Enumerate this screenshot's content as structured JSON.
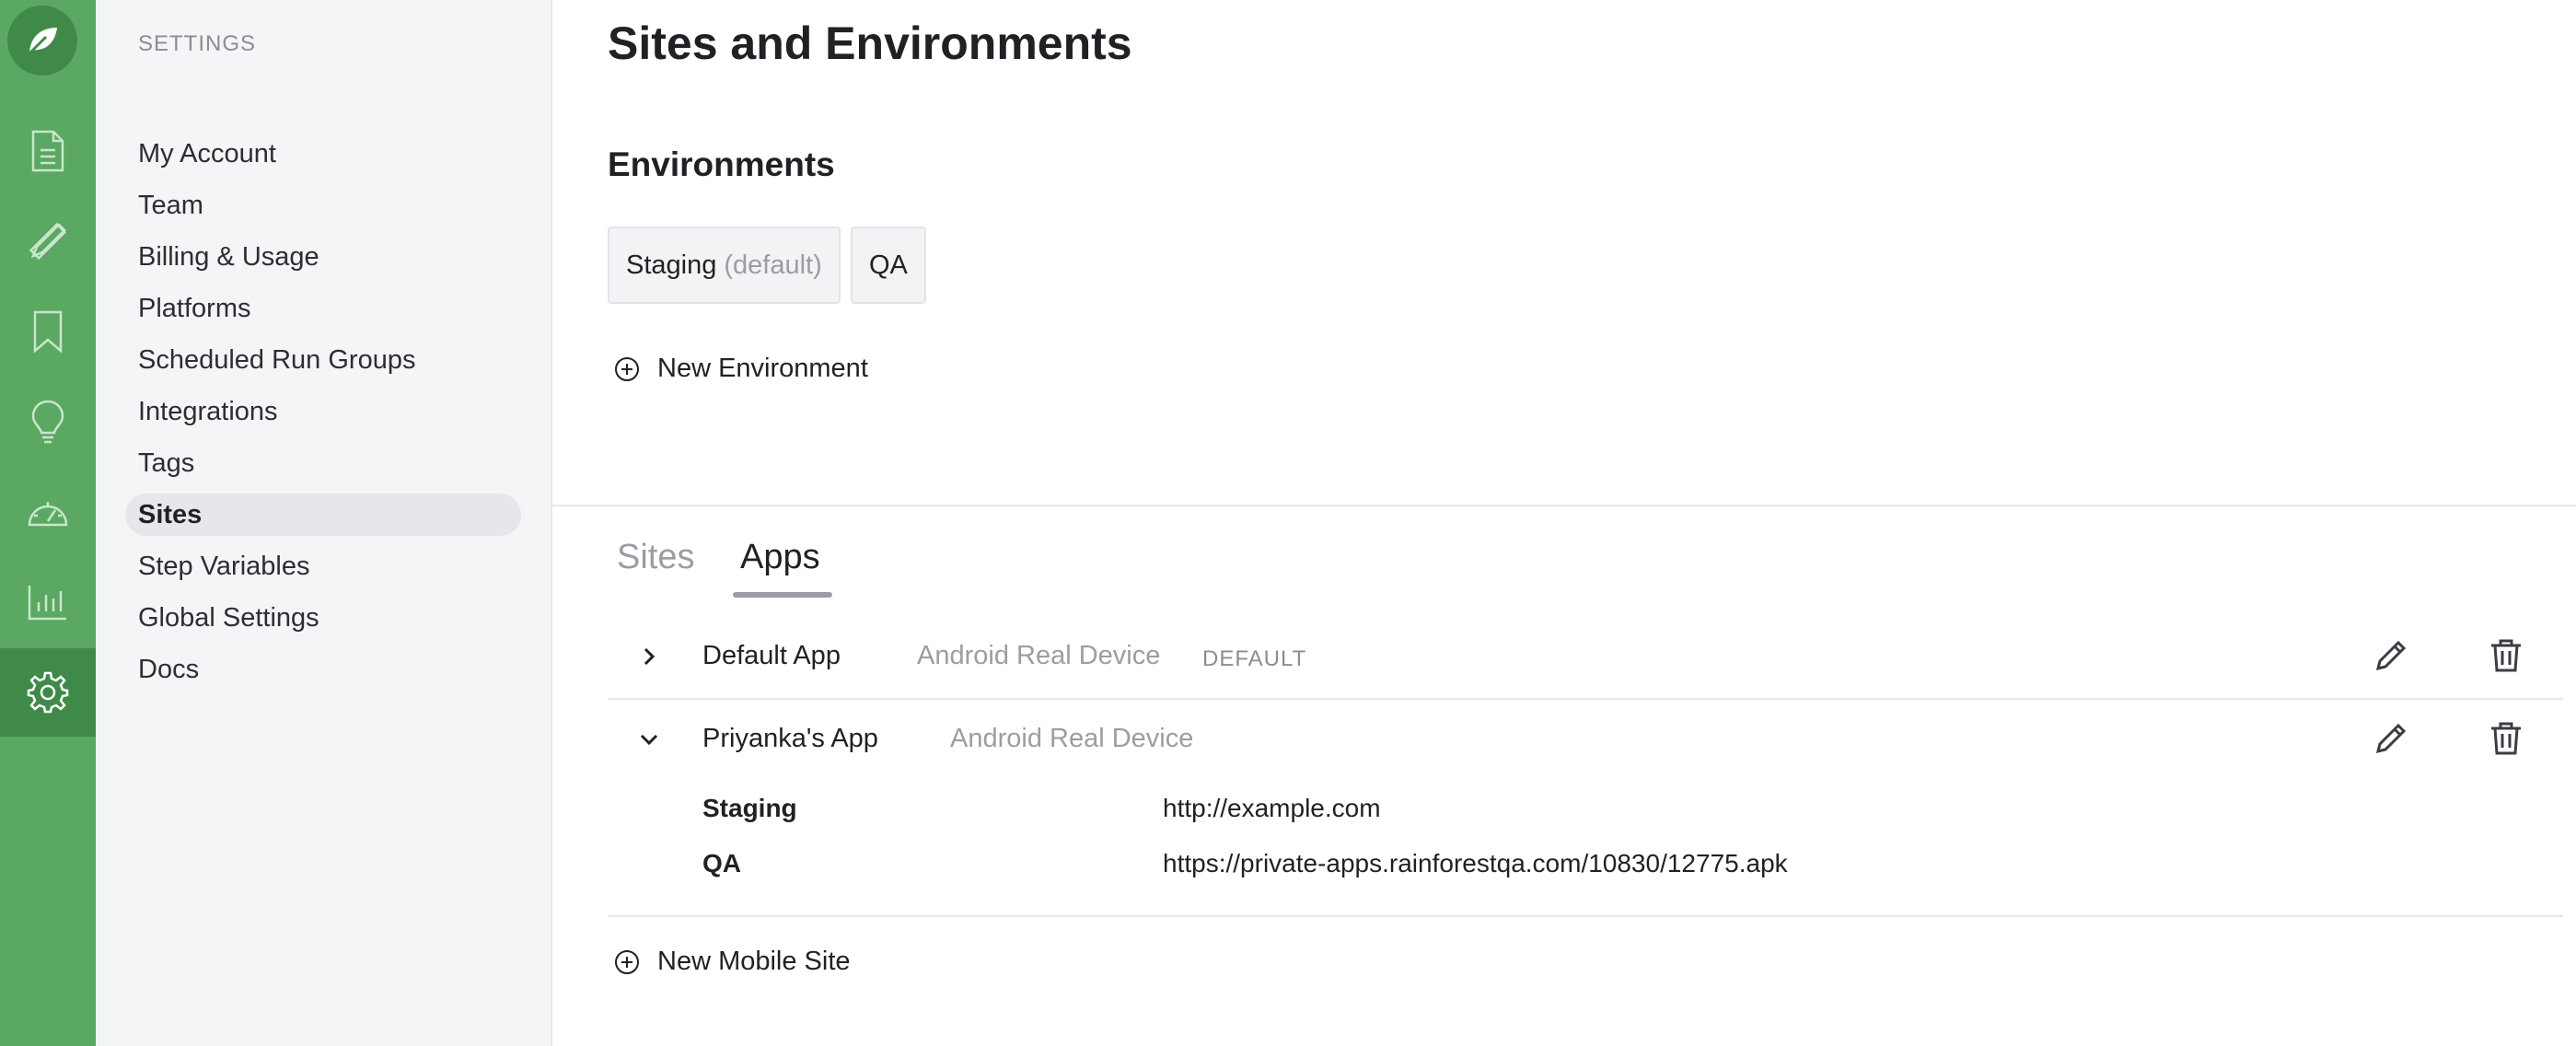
{
  "rail": {
    "icons": [
      "leaf-logo-icon",
      "document-icon",
      "pencil-ruler-icon",
      "bookmark-icon",
      "lightbulb-icon",
      "gauge-icon",
      "bar-chart-icon",
      "gear-icon"
    ],
    "active": "gear-icon",
    "color": "#5aa862",
    "active_color": "#3f8a49"
  },
  "sidebar": {
    "heading": "SETTINGS",
    "items": [
      {
        "label": "My Account"
      },
      {
        "label": "Team"
      },
      {
        "label": "Billing & Usage"
      },
      {
        "label": "Platforms"
      },
      {
        "label": "Scheduled Run Groups"
      },
      {
        "label": "Integrations"
      },
      {
        "label": "Tags"
      },
      {
        "label": "Sites",
        "active": true
      },
      {
        "label": "Step Variables"
      },
      {
        "label": "Global Settings"
      },
      {
        "label": "Docs"
      }
    ]
  },
  "main": {
    "title": "Sites and Environments",
    "environments": {
      "heading": "Environments",
      "chips": [
        {
          "label": "Staging",
          "suffix": "(default)"
        },
        {
          "label": "QA"
        }
      ],
      "new_label": "New Environment"
    },
    "tabs": [
      {
        "label": "Sites",
        "active": false
      },
      {
        "label": "Apps",
        "active": true
      }
    ],
    "apps": [
      {
        "name": "Default App",
        "platform": "Android Real Device",
        "badge": "DEFAULT",
        "expanded": false
      },
      {
        "name": "Priyanka's App",
        "platform": "Android Real Device",
        "expanded": true,
        "urls": [
          {
            "env": "Staging",
            "url": "http://example.com"
          },
          {
            "env": "QA",
            "url": "https://private-apps.rainforestqa.com/10830/12775.apk"
          }
        ]
      }
    ],
    "new_mobile_site_label": "New Mobile Site"
  }
}
